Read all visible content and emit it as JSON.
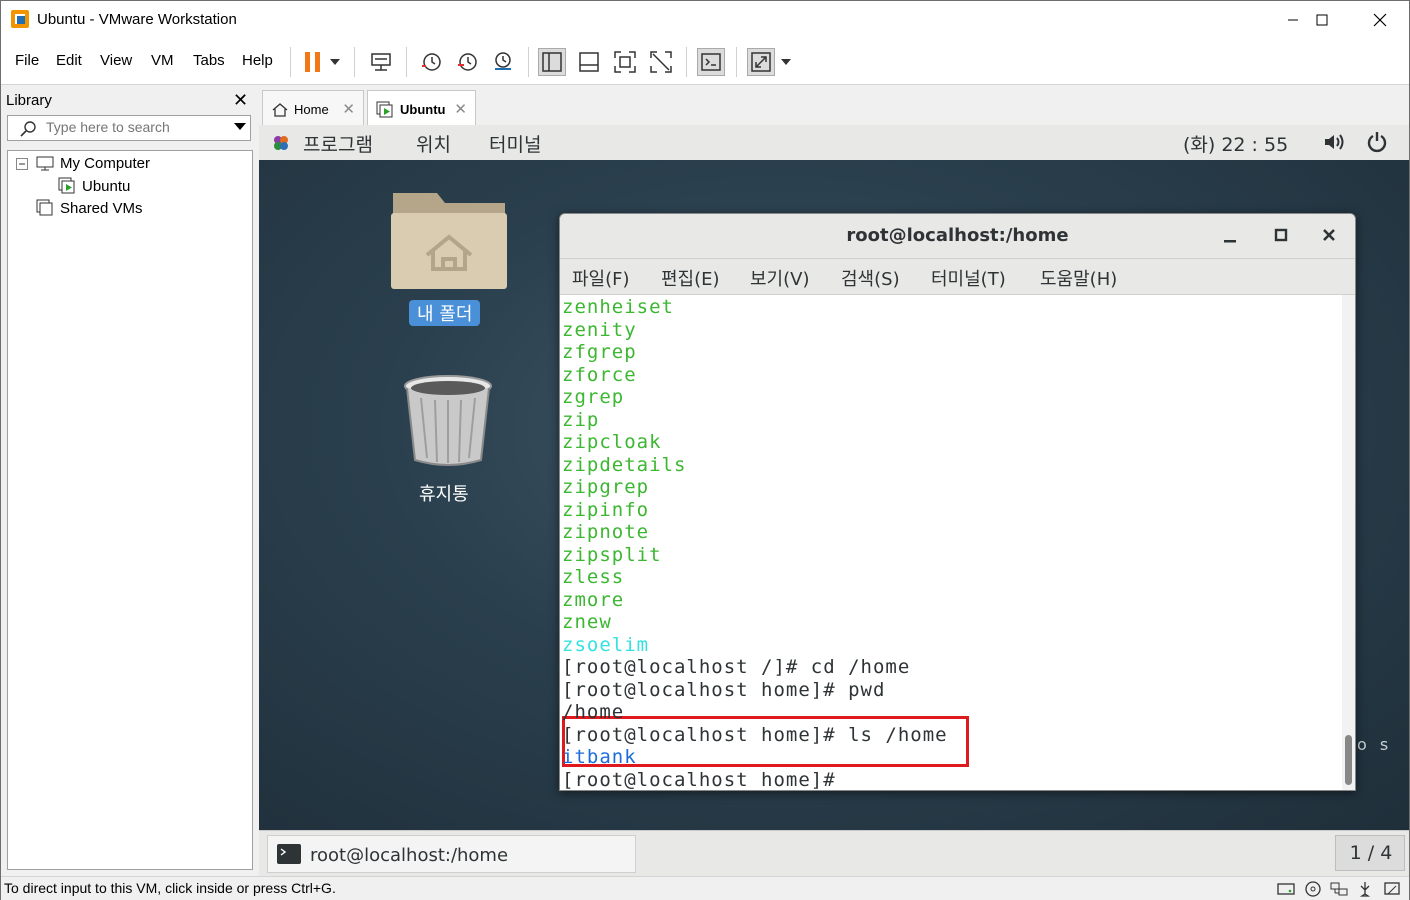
{
  "window": {
    "title": "Ubuntu - VMware Workstation"
  },
  "menu": {
    "file": "File",
    "edit": "Edit",
    "view": "View",
    "vm": "VM",
    "tabs": "Tabs",
    "help": "Help"
  },
  "library": {
    "header": "Library",
    "search_placeholder": "Type here to search",
    "tree": {
      "my_computer": "My Computer",
      "ubuntu": "Ubuntu",
      "shared": "Shared VMs"
    }
  },
  "tabs": {
    "home": "Home",
    "ubuntu": "Ubuntu"
  },
  "gnome": {
    "apps": "프로그램",
    "places": "위치",
    "terminal": "터미널",
    "clock": "(화) 22 : 55",
    "taskbar_item": "root@localhost:/home",
    "workspace": "1 / 4"
  },
  "desktop": {
    "home_folder": "내 폴더",
    "trash": "휴지통",
    "partial_text": "o s"
  },
  "terminal": {
    "title": "root@localhost:/home",
    "menu": [
      "파일(F)",
      "편집(E)",
      "보기(V)",
      "검색(S)",
      "터미널(T)",
      "도움말(H)"
    ],
    "lines": [
      {
        "text": "zenheiset",
        "color": "#3cb731"
      },
      {
        "text": "zenity",
        "color": "#3cb731"
      },
      {
        "text": "zfgrep",
        "color": "#3cb731"
      },
      {
        "text": "zforce",
        "color": "#3cb731"
      },
      {
        "text": "zgrep",
        "color": "#3cb731"
      },
      {
        "text": "zip",
        "color": "#3cb731"
      },
      {
        "text": "zipcloak",
        "color": "#3cb731"
      },
      {
        "text": "zipdetails",
        "color": "#3cb731"
      },
      {
        "text": "zipgrep",
        "color": "#3cb731"
      },
      {
        "text": "zipinfo",
        "color": "#3cb731"
      },
      {
        "text": "zipnote",
        "color": "#3cb731"
      },
      {
        "text": "zipsplit",
        "color": "#3cb731"
      },
      {
        "text": "zless",
        "color": "#3cb731"
      },
      {
        "text": "zmore",
        "color": "#3cb731"
      },
      {
        "text": "znew",
        "color": "#3cb731"
      },
      {
        "text": "zsoelim",
        "color": "#34e2e2"
      },
      {
        "text": "[root@localhost /]# cd /home",
        "color": "#2e3436"
      },
      {
        "text": "[root@localhost home]# pwd",
        "color": "#2e3436"
      },
      {
        "text": "/home",
        "color": "#2e3436"
      },
      {
        "text": "[root@localhost home]# ls /home",
        "color": "#2e3436"
      },
      {
        "text": "itbank",
        "color": "#1c6ddb"
      },
      {
        "text": "[root@localhost home]# ",
        "color": "#2e3436"
      }
    ]
  },
  "status": {
    "text": "To direct input to this VM, click inside or press Ctrl+G."
  }
}
